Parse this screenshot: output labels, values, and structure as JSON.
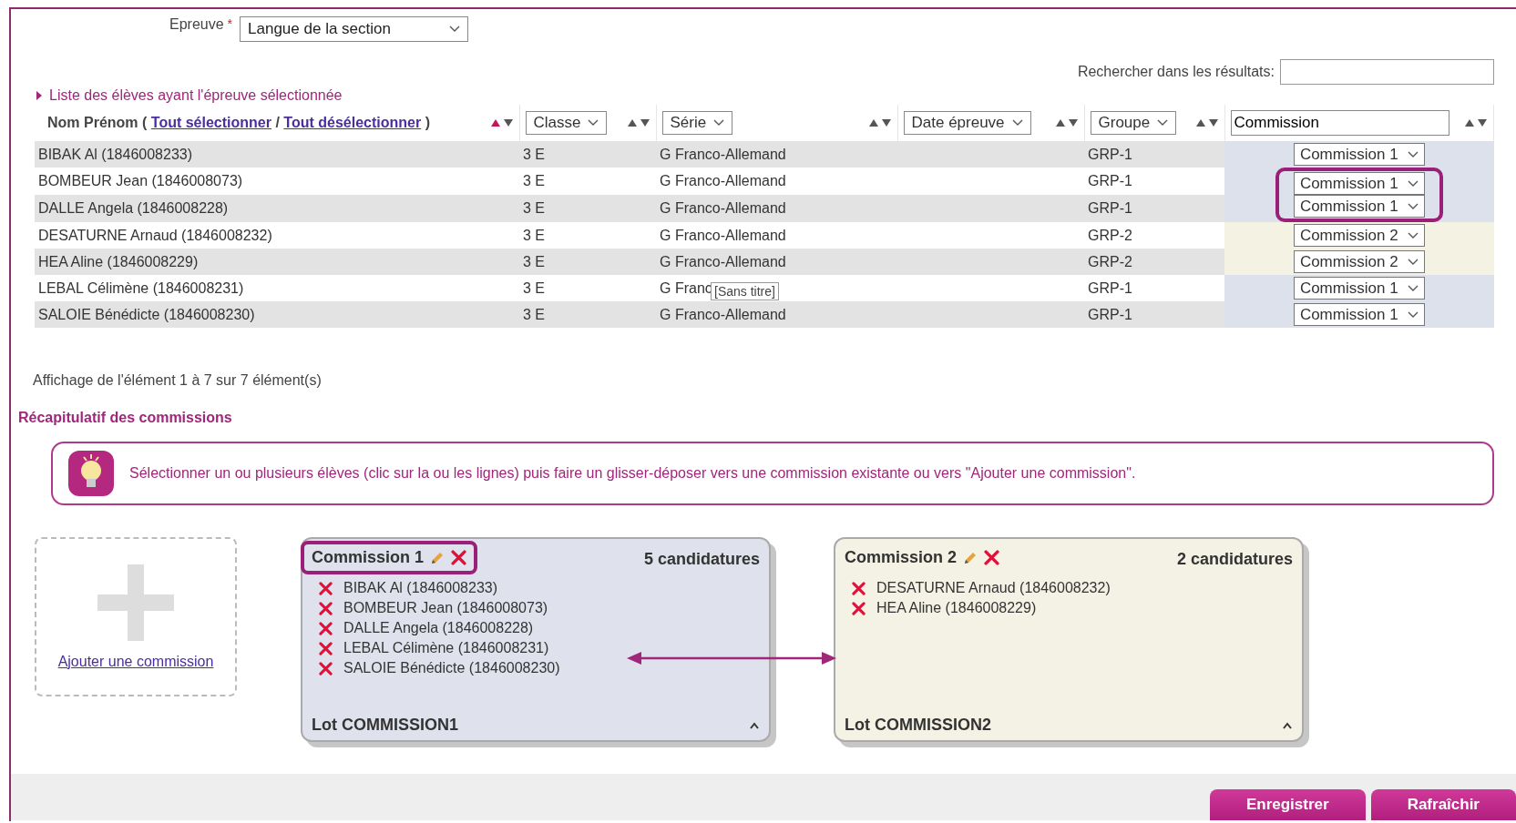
{
  "epreuve": {
    "label": "Epreuve",
    "required_mark": "*",
    "value": "Langue de la section"
  },
  "search": {
    "label": "Rechercher dans les résultats:"
  },
  "list_toggle": {
    "label": "Liste des élèves ayant l'épreuve sélectionnée"
  },
  "table": {
    "name_header": {
      "prefix": "Nom Prénom (",
      "select_all": "Tout sélectionner",
      "separator": "/",
      "deselect_all": "Tout désélectionner",
      "suffix": ")",
      "sorted": true
    },
    "columns": [
      {
        "kind": "dropdown",
        "label": "Classe",
        "sorted": false
      },
      {
        "kind": "dropdown",
        "label": "Série",
        "sorted": false
      },
      {
        "kind": "dropdown",
        "label": "Date épreuve",
        "sorted": false
      },
      {
        "kind": "dropdown",
        "label": "Groupe",
        "sorted": false
      },
      {
        "kind": "text",
        "value": "Commission",
        "sorted": false
      }
    ],
    "rows": [
      {
        "name": "BIBAK Al (1846008233)",
        "classe": "3 E",
        "serie": "G Franco-Allemand",
        "groupe": "GRP-1",
        "commission": "Commission 1",
        "color": "#dde1ec",
        "highlighted": false
      },
      {
        "name": "BOMBEUR Jean (1846008073)",
        "classe": "3 E",
        "serie": "G Franco-Allemand",
        "groupe": "GRP-1",
        "commission": "Commission 1",
        "color": "#dde1ec",
        "highlighted": true
      },
      {
        "name": "DALLE Angela (1846008228)",
        "classe": "3 E",
        "serie": "G Franco-Allemand",
        "groupe": "GRP-1",
        "commission": "Commission 1",
        "color": "#dde1ec",
        "highlighted": true
      },
      {
        "name": "DESATURNE Arnaud (1846008232)",
        "classe": "3 E",
        "serie": "G Franco-Allemand",
        "groupe": "GRP-2",
        "commission": "Commission 2",
        "color": "#f4f3e3",
        "highlighted": false
      },
      {
        "name": "HEA Aline (1846008229)",
        "classe": "3 E",
        "serie": "G Franco-Allemand",
        "groupe": "GRP-2",
        "commission": "Commission 2",
        "color": "#f4f3e3",
        "highlighted": false
      },
      {
        "name": "LEBAL Célimène (1846008231)",
        "classe": "3 E",
        "serie": "G Franc",
        "groupe": "GRP-1",
        "commission": "Commission 1",
        "color": "#dde1ec",
        "highlighted": false,
        "tooltip": "[Sans titre]"
      },
      {
        "name": "SALOIE Bénédicte (1846008230)",
        "classe": "3 E",
        "serie": "G Franco-Allemand",
        "groupe": "GRP-1",
        "commission": "Commission 1",
        "color": "#dde1ec",
        "highlighted": false
      }
    ]
  },
  "info": "Affichage de l'élément 1 à 7 sur 7 élément(s)",
  "summary_title": "Récapitulatif des commissions",
  "tip": "Sélectionner un ou plusieurs élèves (clic sur la ou les lignes) puis faire un glisser-déposer vers une commission existante ou vers \"Ajouter une commission\".",
  "add_commission": {
    "label": "Ajouter une commission"
  },
  "commissions": [
    {
      "name": "Commission 1",
      "count": "5 candidatures",
      "color": "#dfe2ec",
      "highlighted": true,
      "members": [
        "BIBAK Al (1846008233)",
        "BOMBEUR Jean (1846008073)",
        "DALLE Angela (1846008228)",
        "LEBAL Célimène (1846008231)",
        "SALOIE Bénédicte (1846008230)"
      ],
      "lot": "Lot COMMISSION1"
    },
    {
      "name": "Commission 2",
      "count": "2 candidatures",
      "color": "#f3f2e4",
      "highlighted": false,
      "members": [
        "DESATURNE Arnaud (1846008232)",
        "HEA Aline (1846008229)"
      ],
      "lot": "Lot COMMISSION2"
    }
  ],
  "buttons": [
    "Enregistrer",
    "Rafraîchir"
  ]
}
